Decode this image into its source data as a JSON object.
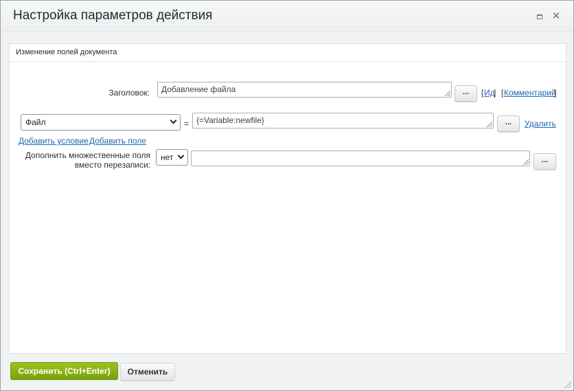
{
  "dialog": {
    "title": "Настройка параметров действия",
    "maximize_icon": "maximize-icon",
    "close_icon": "close-icon",
    "close_glyph": "✕"
  },
  "section": {
    "title": "Изменение полей документа"
  },
  "title_row": {
    "label": "Заголовок:",
    "value": "Добавление файла",
    "dots_label": "...",
    "id_open": "[",
    "id_link": "Ид",
    "id_close": "]",
    "comment_open": "[",
    "comment_link": "Комментарий",
    "comment_close": "]"
  },
  "field_row": {
    "field_select": "Файл",
    "equals": "=",
    "value": "{=Variable:newfile}",
    "dots_label": "...",
    "delete_link": "Удалить"
  },
  "links": {
    "add_condition": "Добавить условие",
    "add_field": "Добавить поле"
  },
  "append_row": {
    "label_line1": "Дополнить множественные поля",
    "label_line2": "вместо перезаписи:",
    "select_value": "нет",
    "value": "",
    "dots_label": "..."
  },
  "footer": {
    "save_label": "Сохранить (Ctrl+Enter)",
    "cancel_label": "Отменить"
  },
  "colors": {
    "save_button": "#7aa10e",
    "link": "#2067b0"
  }
}
